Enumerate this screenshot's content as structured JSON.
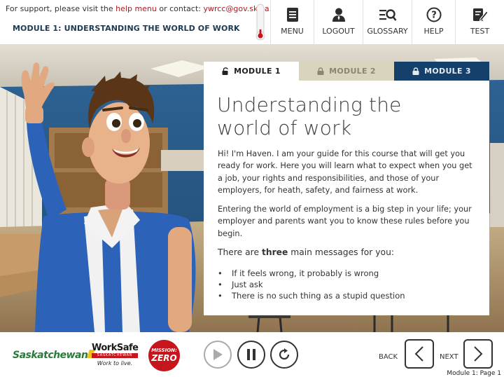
{
  "header": {
    "support_prefix": "For support, please visit the ",
    "support_link": "help menu",
    "support_middle": " or contact: ",
    "support_email": "ywrcc@gov.sk.ca",
    "support_suffix": ".",
    "module_title": "MODULE 1: UNDERSTANDING THE WORLD OF WORK",
    "nav": [
      {
        "label": "MENU",
        "icon": "menu-icon"
      },
      {
        "label": "LOGOUT",
        "icon": "user-icon"
      },
      {
        "label": "GLOSSARY",
        "icon": "glossary-icon"
      },
      {
        "label": "HELP",
        "icon": "help-icon"
      },
      {
        "label": "TEST",
        "icon": "test-icon"
      }
    ]
  },
  "tabs": [
    {
      "label": "MODULE 1",
      "state": "unlocked"
    },
    {
      "label": "MODULE 2",
      "state": "locked"
    },
    {
      "label": "MODULE 3",
      "state": "locked"
    }
  ],
  "content": {
    "title_line1": "Understanding the",
    "title_line2": "world of work",
    "para1": "Hi! I'm Haven. I am your guide for this course that will get you ready for work. Here you will learn what to expect when you get a job, your rights and responsibilities, and those of your employers, for heath, safety, and fairness at work.",
    "para2": "Entering the world of employment is a big step in your life; your employer and parents want you to know these rules before you begin.",
    "three_pre": "There are ",
    "three_bold": "three",
    "three_post": " main messages for you:",
    "bullets": [
      "If it feels wrong, it probably is wrong",
      "Just ask",
      "There is no such thing as a stupid question"
    ]
  },
  "footer": {
    "logo_sk": "Saskatchewan",
    "logo_ws_1": "WorkSafe",
    "logo_ws_2": "SASKATCHEWAN",
    "logo_ws_3": "Work to live.",
    "logo_mz_1": "MISSION:",
    "logo_mz_2": "ZERO",
    "back_label": "BACK",
    "next_label": "NEXT",
    "page_label": "Module 1: Page 1"
  },
  "colors": {
    "brand_red": "#b0191e",
    "navy": "#15406b",
    "tab_locked": "#d9d4bc"
  }
}
